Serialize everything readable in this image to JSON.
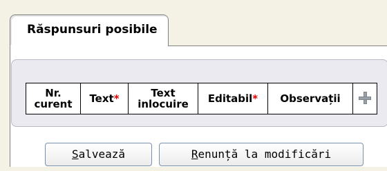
{
  "tab": {
    "label": "Răspunsuri posibile"
  },
  "grid": {
    "headers": {
      "nr_line1": "Nr.",
      "nr_line2": "curent",
      "text": "Text",
      "text_required_mark": "*",
      "inlocuire_line1": "Text",
      "inlocuire_line2": "inlocuire",
      "editabil": "Editabil",
      "editabil_required_mark": "*",
      "observatii": "Observații"
    },
    "add_icon": "plus-icon"
  },
  "buttons": {
    "save_accel": "S",
    "save_rest": "alvează",
    "cancel_accel": "R",
    "cancel_rest": "enunță la modificări"
  },
  "colors": {
    "background": "#f4f2e4",
    "required": "#e00000",
    "grid_box": "#eaeaf0"
  }
}
